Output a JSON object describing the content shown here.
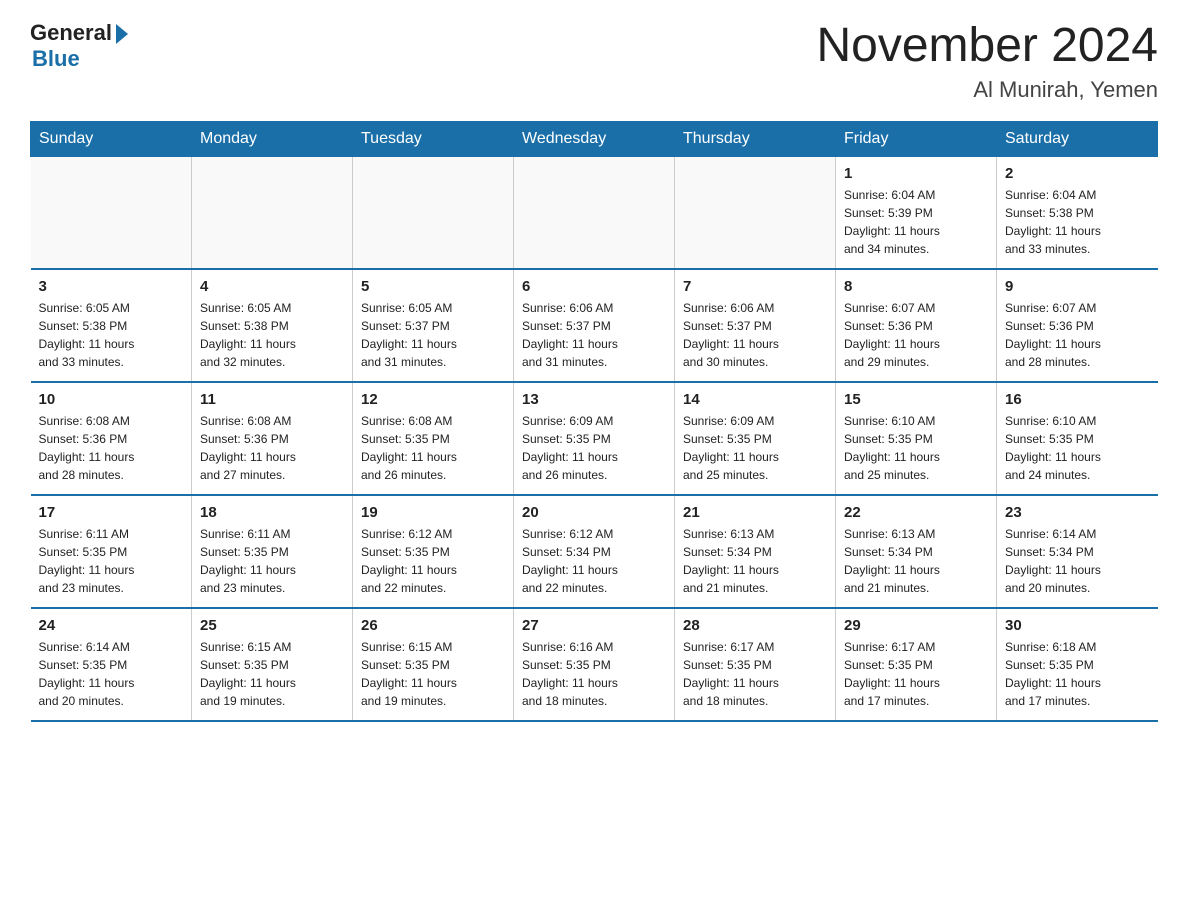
{
  "logo": {
    "general": "General",
    "blue": "Blue"
  },
  "title": "November 2024",
  "subtitle": "Al Munirah, Yemen",
  "weekdays": [
    "Sunday",
    "Monday",
    "Tuesday",
    "Wednesday",
    "Thursday",
    "Friday",
    "Saturday"
  ],
  "weeks": [
    [
      {
        "day": "",
        "info": ""
      },
      {
        "day": "",
        "info": ""
      },
      {
        "day": "",
        "info": ""
      },
      {
        "day": "",
        "info": ""
      },
      {
        "day": "",
        "info": ""
      },
      {
        "day": "1",
        "info": "Sunrise: 6:04 AM\nSunset: 5:39 PM\nDaylight: 11 hours\nand 34 minutes."
      },
      {
        "day": "2",
        "info": "Sunrise: 6:04 AM\nSunset: 5:38 PM\nDaylight: 11 hours\nand 33 minutes."
      }
    ],
    [
      {
        "day": "3",
        "info": "Sunrise: 6:05 AM\nSunset: 5:38 PM\nDaylight: 11 hours\nand 33 minutes."
      },
      {
        "day": "4",
        "info": "Sunrise: 6:05 AM\nSunset: 5:38 PM\nDaylight: 11 hours\nand 32 minutes."
      },
      {
        "day": "5",
        "info": "Sunrise: 6:05 AM\nSunset: 5:37 PM\nDaylight: 11 hours\nand 31 minutes."
      },
      {
        "day": "6",
        "info": "Sunrise: 6:06 AM\nSunset: 5:37 PM\nDaylight: 11 hours\nand 31 minutes."
      },
      {
        "day": "7",
        "info": "Sunrise: 6:06 AM\nSunset: 5:37 PM\nDaylight: 11 hours\nand 30 minutes."
      },
      {
        "day": "8",
        "info": "Sunrise: 6:07 AM\nSunset: 5:36 PM\nDaylight: 11 hours\nand 29 minutes."
      },
      {
        "day": "9",
        "info": "Sunrise: 6:07 AM\nSunset: 5:36 PM\nDaylight: 11 hours\nand 28 minutes."
      }
    ],
    [
      {
        "day": "10",
        "info": "Sunrise: 6:08 AM\nSunset: 5:36 PM\nDaylight: 11 hours\nand 28 minutes."
      },
      {
        "day": "11",
        "info": "Sunrise: 6:08 AM\nSunset: 5:36 PM\nDaylight: 11 hours\nand 27 minutes."
      },
      {
        "day": "12",
        "info": "Sunrise: 6:08 AM\nSunset: 5:35 PM\nDaylight: 11 hours\nand 26 minutes."
      },
      {
        "day": "13",
        "info": "Sunrise: 6:09 AM\nSunset: 5:35 PM\nDaylight: 11 hours\nand 26 minutes."
      },
      {
        "day": "14",
        "info": "Sunrise: 6:09 AM\nSunset: 5:35 PM\nDaylight: 11 hours\nand 25 minutes."
      },
      {
        "day": "15",
        "info": "Sunrise: 6:10 AM\nSunset: 5:35 PM\nDaylight: 11 hours\nand 25 minutes."
      },
      {
        "day": "16",
        "info": "Sunrise: 6:10 AM\nSunset: 5:35 PM\nDaylight: 11 hours\nand 24 minutes."
      }
    ],
    [
      {
        "day": "17",
        "info": "Sunrise: 6:11 AM\nSunset: 5:35 PM\nDaylight: 11 hours\nand 23 minutes."
      },
      {
        "day": "18",
        "info": "Sunrise: 6:11 AM\nSunset: 5:35 PM\nDaylight: 11 hours\nand 23 minutes."
      },
      {
        "day": "19",
        "info": "Sunrise: 6:12 AM\nSunset: 5:35 PM\nDaylight: 11 hours\nand 22 minutes."
      },
      {
        "day": "20",
        "info": "Sunrise: 6:12 AM\nSunset: 5:34 PM\nDaylight: 11 hours\nand 22 minutes."
      },
      {
        "day": "21",
        "info": "Sunrise: 6:13 AM\nSunset: 5:34 PM\nDaylight: 11 hours\nand 21 minutes."
      },
      {
        "day": "22",
        "info": "Sunrise: 6:13 AM\nSunset: 5:34 PM\nDaylight: 11 hours\nand 21 minutes."
      },
      {
        "day": "23",
        "info": "Sunrise: 6:14 AM\nSunset: 5:34 PM\nDaylight: 11 hours\nand 20 minutes."
      }
    ],
    [
      {
        "day": "24",
        "info": "Sunrise: 6:14 AM\nSunset: 5:35 PM\nDaylight: 11 hours\nand 20 minutes."
      },
      {
        "day": "25",
        "info": "Sunrise: 6:15 AM\nSunset: 5:35 PM\nDaylight: 11 hours\nand 19 minutes."
      },
      {
        "day": "26",
        "info": "Sunrise: 6:15 AM\nSunset: 5:35 PM\nDaylight: 11 hours\nand 19 minutes."
      },
      {
        "day": "27",
        "info": "Sunrise: 6:16 AM\nSunset: 5:35 PM\nDaylight: 11 hours\nand 18 minutes."
      },
      {
        "day": "28",
        "info": "Sunrise: 6:17 AM\nSunset: 5:35 PM\nDaylight: 11 hours\nand 18 minutes."
      },
      {
        "day": "29",
        "info": "Sunrise: 6:17 AM\nSunset: 5:35 PM\nDaylight: 11 hours\nand 17 minutes."
      },
      {
        "day": "30",
        "info": "Sunrise: 6:18 AM\nSunset: 5:35 PM\nDaylight: 11 hours\nand 17 minutes."
      }
    ]
  ]
}
